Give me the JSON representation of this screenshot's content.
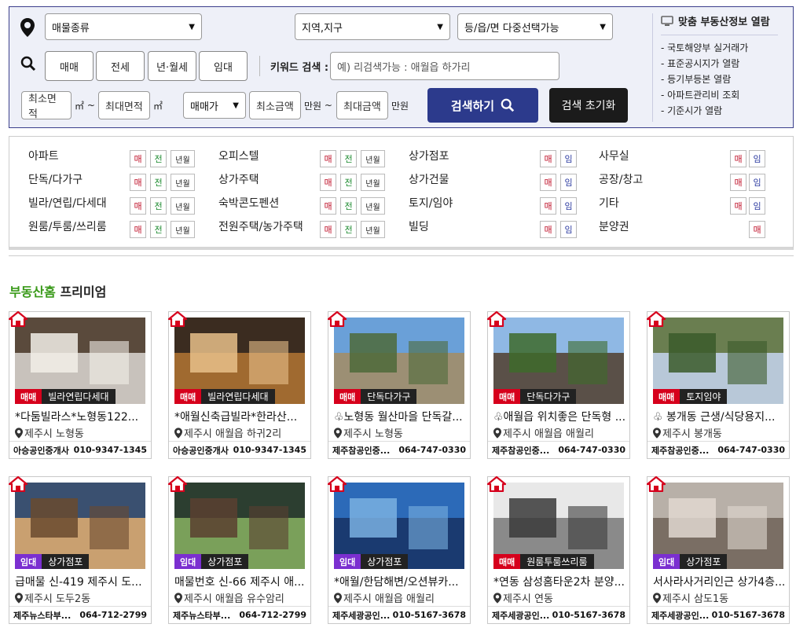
{
  "search": {
    "property_type": "매물종류",
    "region": "지역,지구",
    "town": "등/읍/면 다중선택가능",
    "deal_buttons": [
      "매매",
      "전세",
      "년·월세",
      "임대"
    ],
    "keyword_label": "키워드 검색 :",
    "keyword_placeholder": "예) 리검색가능 : 애월읍 하가리",
    "min_area": "최소면적",
    "max_area": "최대면적",
    "area_unit": "㎡",
    "tilde": "~",
    "price_type": "매매가",
    "min_price": "최소금액",
    "max_price": "최대금액",
    "price_unit": "만원",
    "search_button": "검색하기",
    "reset_button": "검색 초기화"
  },
  "side": {
    "title": "맞춤 부동산정보 열람",
    "links": [
      "- 국토해양부 실거래가",
      "- 표준공시지가 열람",
      "- 등기부등본 열람",
      "- 아파트관리비 조회",
      "- 기준시가 열람"
    ]
  },
  "tags": {
    "m": "매",
    "j": "전",
    "y": "년월",
    "i": "임"
  },
  "categories": [
    [
      "아파트",
      "단독/다가구",
      "빌라/연립/다세대",
      "원룸/투룸/쓰리룸"
    ],
    [
      "오피스텔",
      "상가주택",
      "숙박콘도펜션",
      "전원주택/농가주택"
    ],
    [
      "상가점포",
      "상가건물",
      "토지/임야",
      "빌딩"
    ],
    [
      "사무실",
      "공장/창고",
      "기타",
      "분양권"
    ]
  ],
  "premium": {
    "brand": "부동산홈",
    "label": " 프리미엄"
  },
  "listings": [
    {
      "type": "매매",
      "type_color": "#d6001c",
      "category": "빌라연립다세대",
      "title": "*다둠빌라스*노형동122...",
      "location": "제주시 노형동",
      "agent": "아승공인중개사",
      "phone": "010-9347-1345"
    },
    {
      "type": "매매",
      "type_color": "#d6001c",
      "category": "빌라연립다세대",
      "title": "*애월신축급빌라*한라산...",
      "location": "제주시 애월읍 하귀2리",
      "agent": "아승공인중개사",
      "phone": "010-9347-1345"
    },
    {
      "type": "매매",
      "type_color": "#d6001c",
      "category": "단독다가구",
      "title": "♧노형동 월산마을 단독갈...",
      "location": "제주시 노형동",
      "agent": "제주참공인중...",
      "phone": "064-747-0330"
    },
    {
      "type": "매매",
      "type_color": "#d6001c",
      "category": "단독다가구",
      "title": "♧애월읍 위치좋은 단독형 ...",
      "location": "제주시 애월읍 애월리",
      "agent": "제주참공인중...",
      "phone": "064-747-0330"
    },
    {
      "type": "매매",
      "type_color": "#d6001c",
      "category": "토지임야",
      "title": "♧ 봉개동 근생/식당용지...",
      "location": "제주시 봉개동",
      "agent": "제주참공인중...",
      "phone": "064-747-0330"
    },
    {
      "type": "임대",
      "type_color": "#7b2fd0",
      "category": "상가점포",
      "title": "급매물 신-419 제주시 도...",
      "location": "제주시 도두2동",
      "agent": "제주뉴스타부...",
      "phone": "064-712-2799"
    },
    {
      "type": "임대",
      "type_color": "#7b2fd0",
      "category": "상가점포",
      "title": "매물번호 신-66 제주시 애...",
      "location": "제주시 애월읍 유수암리",
      "agent": "제주뉴스타부...",
      "phone": "064-712-2799"
    },
    {
      "type": "임대",
      "type_color": "#7b2fd0",
      "category": "상가점포",
      "title": "*애월/한담해변/오션뷰카...",
      "location": "제주시 애월읍 애월리",
      "agent": "제주세광공인...",
      "phone": "010-5167-3678"
    },
    {
      "type": "매매",
      "type_color": "#d6001c",
      "category": "원룸투룸쓰리룸",
      "title": "*연동 삼성홈타운2차 분양...",
      "location": "제주시 연동",
      "agent": "제주세광공인...",
      "phone": "010-5167-3678"
    },
    {
      "type": "임대",
      "type_color": "#7b2fd0",
      "category": "상가점포",
      "title": "서사라사거리인근 상가4층...",
      "location": "제주시 삼도1동",
      "agent": "제주세광공인...",
      "phone": "010-5167-3678"
    }
  ],
  "colors": {
    "panel_bg": "#eef0f8",
    "search_btn": "#2c3a8c",
    "brand_green": "#3a9a1a",
    "sale_red": "#d6001c",
    "rent_purple": "#7b2fd0"
  }
}
